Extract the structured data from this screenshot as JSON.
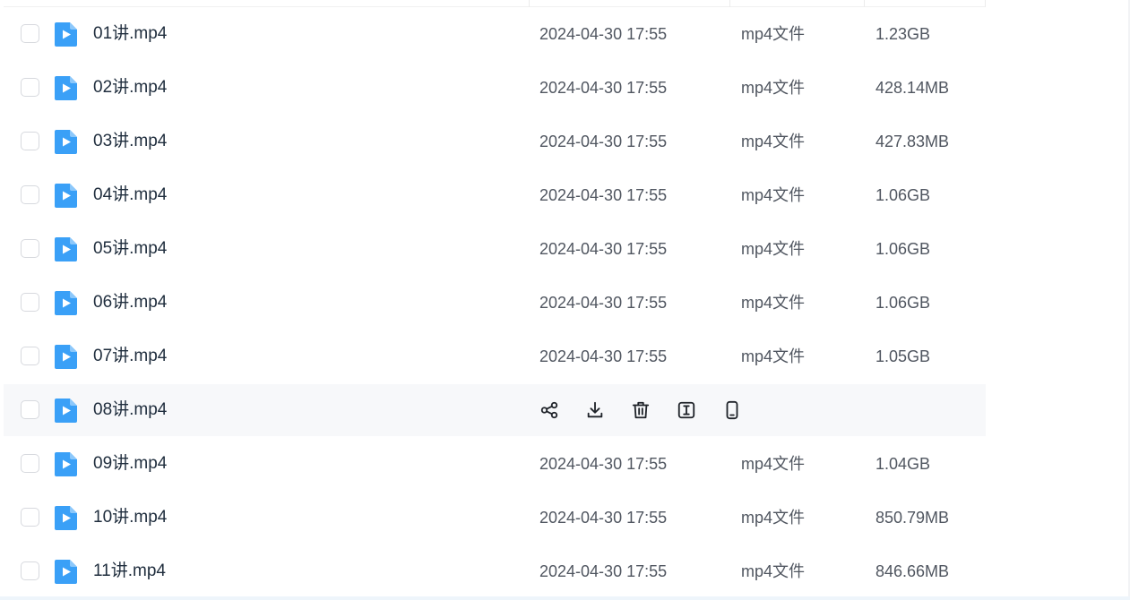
{
  "list": {
    "hovered_row_actions": [
      {
        "icon": "share-icon",
        "title": "分享"
      },
      {
        "icon": "download-icon",
        "title": "下载"
      },
      {
        "icon": "delete-icon",
        "title": "删除"
      },
      {
        "icon": "rename-icon",
        "title": "重命名"
      },
      {
        "icon": "send-to-phone-icon",
        "title": "发送到手机"
      }
    ],
    "rows": [
      {
        "name": "01讲.mp4",
        "time": "2024-04-30 17:55",
        "type": "mp4文件",
        "size": "1.23GB",
        "hover": false
      },
      {
        "name": "02讲.mp4",
        "time": "2024-04-30 17:55",
        "type": "mp4文件",
        "size": "428.14MB",
        "hover": false
      },
      {
        "name": "03讲.mp4",
        "time": "2024-04-30 17:55",
        "type": "mp4文件",
        "size": "427.83MB",
        "hover": false
      },
      {
        "name": "04讲.mp4",
        "time": "2024-04-30 17:55",
        "type": "mp4文件",
        "size": "1.06GB",
        "hover": false
      },
      {
        "name": "05讲.mp4",
        "time": "2024-04-30 17:55",
        "type": "mp4文件",
        "size": "1.06GB",
        "hover": false
      },
      {
        "name": "06讲.mp4",
        "time": "2024-04-30 17:55",
        "type": "mp4文件",
        "size": "1.06GB",
        "hover": false
      },
      {
        "name": "07讲.mp4",
        "time": "2024-04-30 17:55",
        "type": "mp4文件",
        "size": "1.05GB",
        "hover": false
      },
      {
        "name": "08讲.mp4",
        "time": "",
        "type": "",
        "size": "",
        "hover": true
      },
      {
        "name": "09讲.mp4",
        "time": "2024-04-30 17:55",
        "type": "mp4文件",
        "size": "1.04GB",
        "hover": false
      },
      {
        "name": "10讲.mp4",
        "time": "2024-04-30 17:55",
        "type": "mp4文件",
        "size": "850.79MB",
        "hover": false
      },
      {
        "name": "11讲.mp4",
        "time": "2024-04-30 17:55",
        "type": "mp4文件",
        "size": "846.66MB",
        "hover": false
      }
    ]
  },
  "colors": {
    "file_icon": "#3aa0f7",
    "hover_row_bg": "#f7f8fa",
    "text_primary": "#1f2d3d",
    "text_secondary": "#505660"
  }
}
